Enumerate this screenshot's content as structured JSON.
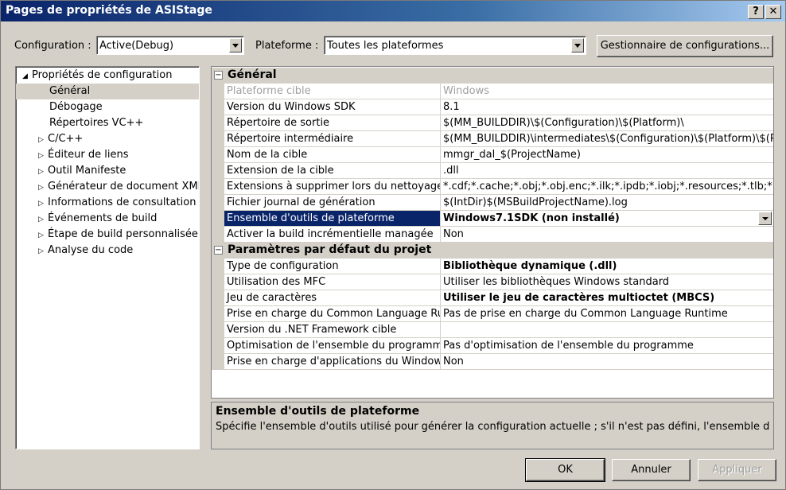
{
  "window": {
    "title": "Pages de propriétés de ASIStage",
    "help_label": "?",
    "close_label": "✕"
  },
  "toolbar": {
    "configuration_label": "Configuration :",
    "configuration_value": "Active(Debug)",
    "platform_label": "Plateforme :",
    "platform_value": "Toutes les plateformes",
    "config_manager_label": "Gestionnaire de configurations..."
  },
  "tree": {
    "root": "Propriétés de configuration",
    "items": [
      "Général",
      "Débogage",
      "Répertoires VC++",
      "C/C++",
      "Éditeur de liens",
      "Outil Manifeste",
      "Générateur de document XML",
      "Informations de consultation",
      "Événements de build",
      "Étape de build personnalisée",
      "Analyse du code"
    ],
    "selected": "Général"
  },
  "grid": {
    "sections": [
      {
        "title": "Général",
        "rows": [
          {
            "name": "Plateforme cible",
            "value": "Windows"
          },
          {
            "name": "Version du Windows SDK",
            "value": "8.1"
          },
          {
            "name": "Répertoire de sortie",
            "value": "$(MM_BUILDDIR)\\$(Configuration)\\$(Platform)\\"
          },
          {
            "name": "Répertoire intermédiaire",
            "value": "$(MM_BUILDDIR)\\intermediates\\$(Configuration)\\$(Platform)\\$(Proj"
          },
          {
            "name": "Nom de la cible",
            "value": "mmgr_dal_$(ProjectName)"
          },
          {
            "name": "Extension de la cible",
            "value": ".dll"
          },
          {
            "name": "Extensions à supprimer lors du nettoyage",
            "value": "*.cdf;*.cache;*.obj;*.obj.enc;*.ilk;*.ipdb;*.iobj;*.resources;*.tlb;*"
          },
          {
            "name": "Fichier journal de génération",
            "value": "$(IntDir)$(MSBuildProjectName).log"
          },
          {
            "name": "Ensemble d'outils de plateforme",
            "value": "Windows7.1SDK (non installé)"
          },
          {
            "name": "Activer la build incrémentielle managée",
            "value": "Non"
          }
        ]
      },
      {
        "title": "Paramètres par défaut du projet",
        "rows": [
          {
            "name": "Type de configuration",
            "value": "Bibliothèque dynamique (.dll)"
          },
          {
            "name": "Utilisation des MFC",
            "value": "Utiliser les bibliothèques Windows standard"
          },
          {
            "name": "Jeu de caractères",
            "value": "Utiliser le jeu de caractères multioctet (MBCS)"
          },
          {
            "name": "Prise en charge du Common Language Runtime",
            "value": "Pas de prise en charge du Common Language Runtime"
          },
          {
            "name": "Version du .NET Framework cible",
            "value": ""
          },
          {
            "name": "Optimisation de l'ensemble du programme",
            "value": "Pas d'optimisation de l'ensemble du programme"
          },
          {
            "name": "Prise en charge d'applications du Windows Store",
            "value": "Non"
          }
        ]
      }
    ]
  },
  "description": {
    "title": "Ensemble d'outils de plateforme",
    "text": "Spécifie l'ensemble d'outils utilisé pour générer la configuration actuelle ; s'il n'est pas défini, l'ensemble d'..."
  },
  "buttons": {
    "ok": "OK",
    "cancel": "Annuler",
    "apply": "Appliquer"
  },
  "colors": {
    "selection": "#0a246a",
    "dialog_bg": "#d4d0c8",
    "disabled_text": "#a0a0a0"
  }
}
